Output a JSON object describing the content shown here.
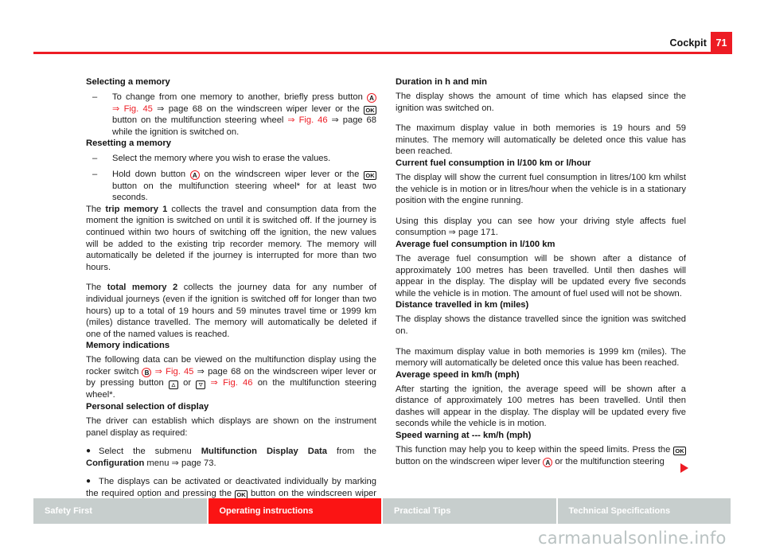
{
  "header": {
    "title": "Cockpit",
    "page_number": "71"
  },
  "left_column": {
    "section1": {
      "heading": "Selecting a memory",
      "items": [
        {
          "dash": "–",
          "text_1": "To change from one memory to another, briefly press button ",
          "key_a": "A",
          "text_2": " ",
          "xref_fig": "⇒ Fig. 45",
          "xref_page": "⇒ page 68",
          "text_3": " on the windscreen wiper lever or the ",
          "key_ok": "OK",
          "text_4": " button on the multifunction steering wheel ",
          "xref_fig2": "⇒ Fig. 46",
          "xref_page2": "⇒ page 68",
          "text_5": " while the ignition is switched on."
        }
      ]
    },
    "section2": {
      "heading": "Resetting a memory",
      "item1": {
        "dash": "–",
        "text": "Select the memory where you wish to erase the values."
      },
      "item2": {
        "dash": "–",
        "text_1": "Hold down button ",
        "key_a": "A",
        "text_2": " on the windscreen wiper lever or the ",
        "key_ok": "OK",
        "text_3": " button on the multifunction steering wheel* for at least two seconds."
      }
    },
    "para_trip": {
      "lead": "The ",
      "bold": "trip memory 1",
      "rest": " collects the travel and consumption data from the moment the ignition is switched on until it is switched off. If the journey is continued within two hours of switching off the ignition, the new values will be added to the existing trip recorder memory. The memory will automatically be deleted if the journey is interrupted for more than two hours."
    },
    "para_total": {
      "lead": "The ",
      "bold": "total memory 2",
      "rest": " collects the journey data for any number of individual journeys (even if the ignition is switched off for longer than two hours) up to a total of 19 hours and 59 minutes travel time or 1999 km (miles) distance travelled. The memory will automatically be deleted if one of the named values is reached."
    },
    "section3": {
      "heading": "Memory indications",
      "text_1": "The following data can be viewed on the multifunction display using the rocker switch ",
      "key_b": "B",
      "text_2": " ",
      "xref_fig": "⇒ Fig. 45",
      "xref_page": "⇒ page 68",
      "text_3": " on the windscreen wiper lever or by pressing button ",
      "key_up": "△",
      "text_4": " or ",
      "key_down": "▽",
      "text_5": " ",
      "xref_fig2": "⇒ Fig. 46",
      "text_6": " on the multifunction steering wheel*."
    },
    "section4": {
      "heading": "Personal selection of display",
      "intro": "The driver can establish which displays are shown on the instrument panel display as required:",
      "bullet1": {
        "marker": "●",
        "text_1": "Select the submenu ",
        "bold_1": "Multifunction Display Data",
        "text_2": " from the ",
        "bold_2": "Configuration",
        "text_3": " menu ",
        "xref_page": "⇒ page 73",
        "text_4": "."
      },
      "bullet2": {
        "marker": "●",
        "text_1": "The displays can be activated or deactivated individually by marking the required option and pressing the ",
        "key_ok": "OK",
        "text_2": " button on the windscreen wiper lever or the multifunction steering wheel*."
      }
    }
  },
  "right_column": {
    "section1": {
      "heading": "Duration in h and min",
      "para1": "The display shows the amount of time which has elapsed since the ignition was switched on.",
      "para2": "The maximum display value in both memories is 19 hours and 59 minutes. The memory will automatically be deleted once this value has been reached."
    },
    "section2": {
      "heading": "Current fuel consumption in l/100 km or l/hour",
      "para1": "The display will show the current fuel consumption in litres/100 km whilst the vehicle is in motion or in litres/hour when the vehicle is in a stationary position with the engine running.",
      "para2_text1": "Using this display you can see how your driving style affects fuel consumption ",
      "para2_xref": "⇒ page 171",
      "para2_text2": "."
    },
    "section3": {
      "heading": "Average fuel consumption in l/100 km",
      "para1": "The average fuel consumption will be shown after a distance of approximately 100 metres has been travelled. Until then dashes will appear in the display. The display will be updated every five seconds while the vehicle is in motion. The amount of fuel used will not be shown."
    },
    "section4": {
      "heading": "Distance travelled in km (miles)",
      "para1": "The display shows the distance travelled since the ignition was switched on.",
      "para2": "The maximum display value in both memories is 1999 km (miles). The memory will automatically be deleted once this value has been reached."
    },
    "section5": {
      "heading": "Average speed in km/h (mph)",
      "para1": "After starting the ignition, the average speed will be shown after a distance of approximately 100 metres has been travelled. Until then dashes will appear in the display. The display will be updated every five seconds while the vehicle is in motion."
    },
    "section6": {
      "heading": "Speed warning at --- km/h (mph)",
      "text_1": "This function may help you to keep within the speed limits. Press the ",
      "key_ok": "OK",
      "text_2": " button on the windscreen wiper lever ",
      "key_a": "A",
      "text_3": " or the multifunction steering"
    }
  },
  "footer": {
    "tabs": [
      {
        "label": "Safety First",
        "active": false
      },
      {
        "label": "Operating instructions",
        "active": true
      },
      {
        "label": "Practical Tips",
        "active": false
      },
      {
        "label": "Technical Specifications",
        "active": false
      }
    ]
  },
  "watermark": "carmanualsonline.info",
  "colors": {
    "accent_red": "#ed1c24",
    "tab_red": "#fb1414",
    "tab_grey": "#c7cecd",
    "watermark_grey": "#b9c2c2"
  }
}
